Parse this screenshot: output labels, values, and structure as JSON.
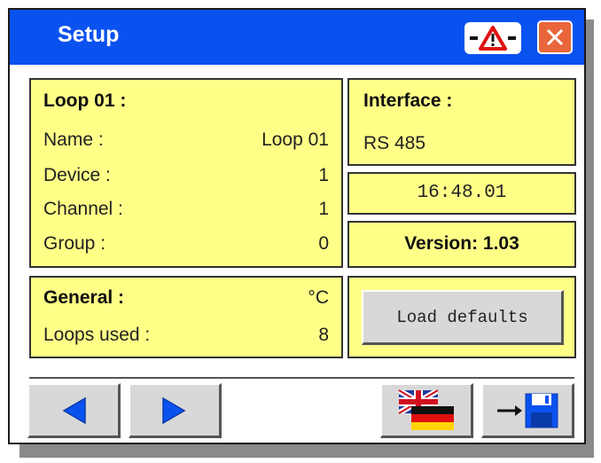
{
  "window": {
    "title": "Setup",
    "warning_label": "-⚠-",
    "close_label": "✕"
  },
  "loop": {
    "heading": "Loop 01 :",
    "rows": [
      {
        "label": "Name :",
        "value": "Loop 01"
      },
      {
        "label": "Device :",
        "value": "1"
      },
      {
        "label": "Channel :",
        "value": "1"
      },
      {
        "label": "Group :",
        "value": "0"
      }
    ]
  },
  "general": {
    "heading": "General :",
    "unit": "°C",
    "loops_used_label": "Loops used :",
    "loops_used_value": "8"
  },
  "interface": {
    "heading": "Interface :",
    "value": "RS 485"
  },
  "clock": "16:48.01",
  "version": "Version: 1.03",
  "load_defaults_label": "Load defaults",
  "colors": {
    "titlebar": "#0a52f0",
    "panel": "#ffff88",
    "accent_blue": "#0a52f0",
    "close": "#e8663a"
  },
  "icons": {
    "prev": "arrow-left-icon",
    "next": "arrow-right-icon",
    "language": "flag-uk-de-icon",
    "save": "save-disk-icon",
    "warning": "warning-triangle-icon"
  }
}
